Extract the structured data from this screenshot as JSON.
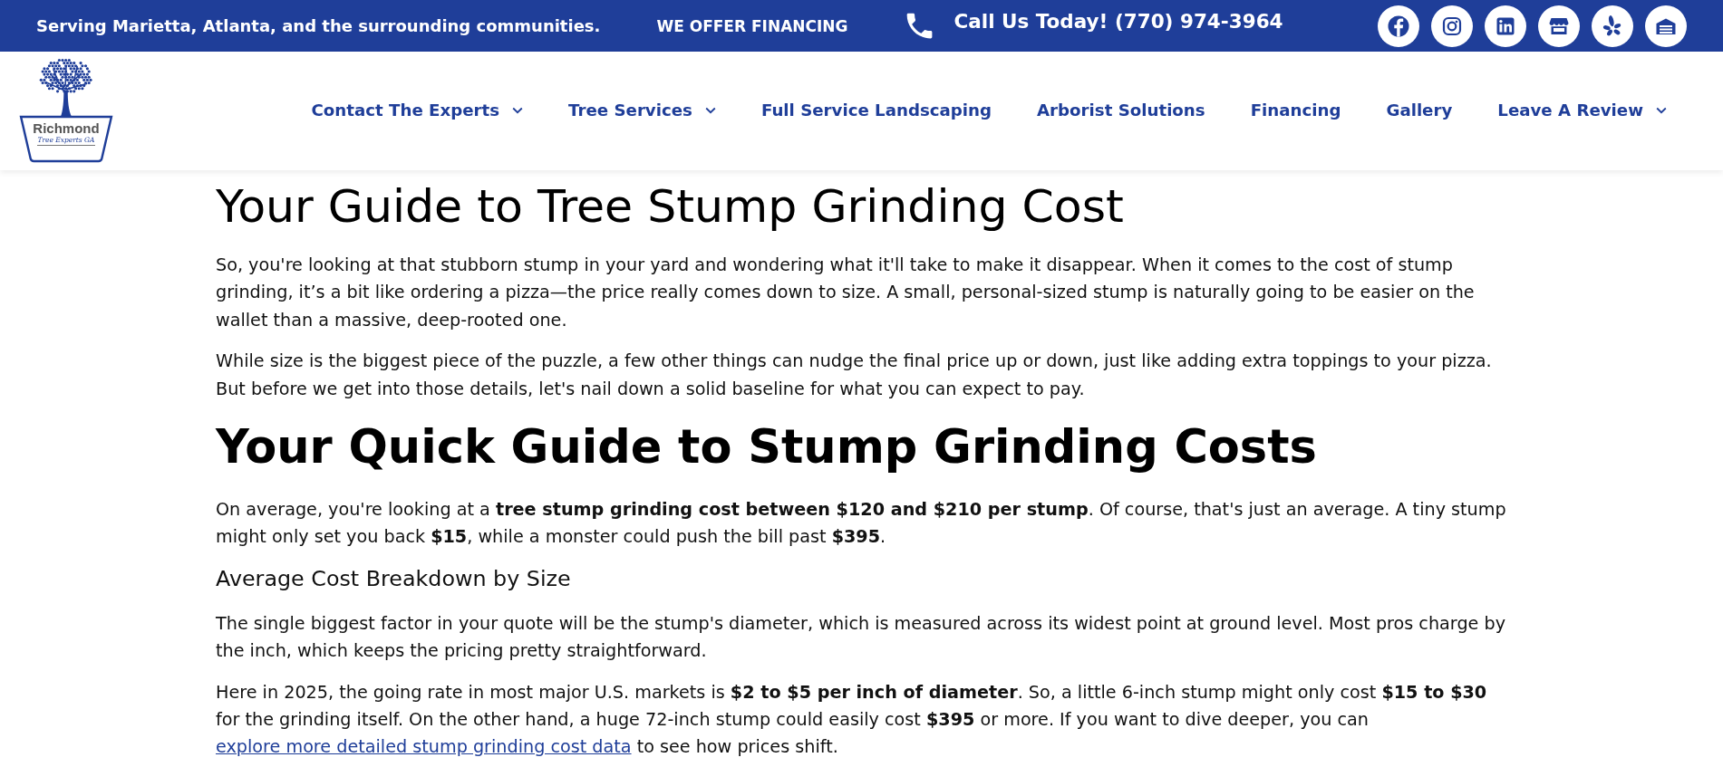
{
  "top_bar": {
    "tagline": "Serving Marietta, Atlanta, and the surrounding communities.",
    "financing_link": "WE OFFER FINANCING",
    "phone": "Call Us Today! (770) 974-3964",
    "social": [
      {
        "kind": "facebook"
      },
      {
        "kind": "instagram"
      },
      {
        "kind": "linkedin"
      },
      {
        "kind": "store"
      },
      {
        "kind": "yelp"
      },
      {
        "kind": "garage"
      }
    ]
  },
  "header": {
    "logo": {
      "name": "Richmond",
      "tagline": "Tree Experts GA"
    },
    "nav": [
      {
        "label": "Contact The Experts",
        "dropdown": true
      },
      {
        "label": "Tree Services",
        "dropdown": true
      },
      {
        "label": "Full Service Landscaping",
        "dropdown": false
      },
      {
        "label": "Arborist Solutions",
        "dropdown": false
      },
      {
        "label": "Financing",
        "dropdown": false
      },
      {
        "label": "Gallery",
        "dropdown": false
      },
      {
        "label": "Leave A Review",
        "dropdown": true
      }
    ]
  },
  "article": {
    "blocks": [
      {
        "kind": "title",
        "text": "Your Guide to Tree Stump Grinding Cost"
      },
      {
        "kind": "paragraph",
        "text": "So, you're looking at that stubborn stump in your yard and wondering what it'll take to make it disappear. When it comes to the cost of stump grinding, it’s a bit like ordering a pizza—the price really comes down to size. A small, personal-sized stump is naturally going to be easier on the wallet than a massive, deep-rooted one."
      },
      {
        "kind": "paragraph",
        "text": "While size is the biggest piece of the puzzle, a few other things can nudge the final price up or down, just like adding extra toppings to your pizza. But before we get into those details, let's nail down a solid baseline for what you can expect to pay."
      },
      {
        "kind": "section_heading",
        "text": "Your Quick Guide to Stump Grinding Costs"
      },
      {
        "kind": "paragraph",
        "text": "On average, you're looking at a **tree stump grinding cost between $120 and $210 per stump**. Of course, that's just an average. A tiny stump might only set you back **$15**, while a monster could push the bill past **$395**."
      },
      {
        "kind": "subheading",
        "text": "Average Cost Breakdown by Size"
      },
      {
        "kind": "paragraph",
        "text": "The single biggest factor in your quote will be the stump's diameter, which is measured across its widest point at ground level. Most pros charge by the inch, which keeps the pricing pretty straightforward."
      },
      {
        "kind": "paragraph",
        "parts": [
          {
            "kind": "text",
            "text": "Here in 2025, the going rate in most major U.S. markets is **$2 to $5 per inch of diameter**. So, a little 6-inch stump might only cost **$15 to $30** for the grinding itself. On the other hand, a huge 72-inch stump could easily cost **$395** or more. If you want to dive deeper, you can "
          },
          {
            "kind": "link",
            "text": "explore more detailed stump grinding cost data"
          },
          {
            "kind": "text",
            "text": " to see how prices shift."
          }
        ]
      }
    ]
  }
}
